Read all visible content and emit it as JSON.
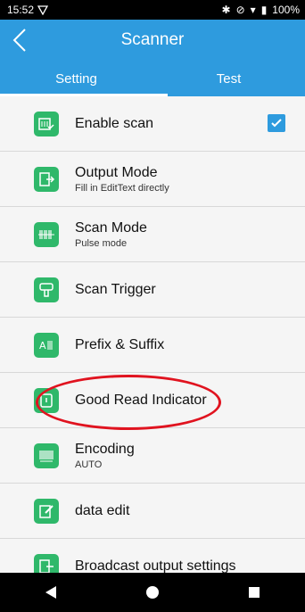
{
  "status": {
    "time": "15:52",
    "battery": "100%"
  },
  "appbar": {
    "title": "Scanner"
  },
  "tabs": [
    {
      "label": "Setting",
      "active": true
    },
    {
      "label": "Test",
      "active": false
    }
  ],
  "colors": {
    "primary": "#2e9bde",
    "icon_green": "#2fb86a",
    "annotation_red": "#e0131f"
  },
  "list": {
    "items": [
      {
        "label": "Enable scan",
        "sub": "",
        "icon": "scan-enable-icon",
        "checked": true
      },
      {
        "label": "Output Mode",
        "sub": "Fill in EditText directly",
        "icon": "output-icon"
      },
      {
        "label": "Scan Mode",
        "sub": "Pulse mode",
        "icon": "scan-mode-icon"
      },
      {
        "label": "Scan Trigger",
        "sub": "",
        "icon": "trigger-icon"
      },
      {
        "label": "Prefix & Suffix",
        "sub": "",
        "icon": "prefix-icon"
      },
      {
        "label": "Good Read Indicator",
        "sub": "",
        "icon": "indicator-icon"
      },
      {
        "label": "Encoding",
        "sub": "AUTO",
        "icon": "barcode-icon"
      },
      {
        "label": "data edit",
        "sub": "",
        "icon": "edit-icon"
      },
      {
        "label": "Broadcast output settings",
        "sub": "",
        "icon": "broadcast-icon"
      }
    ]
  }
}
